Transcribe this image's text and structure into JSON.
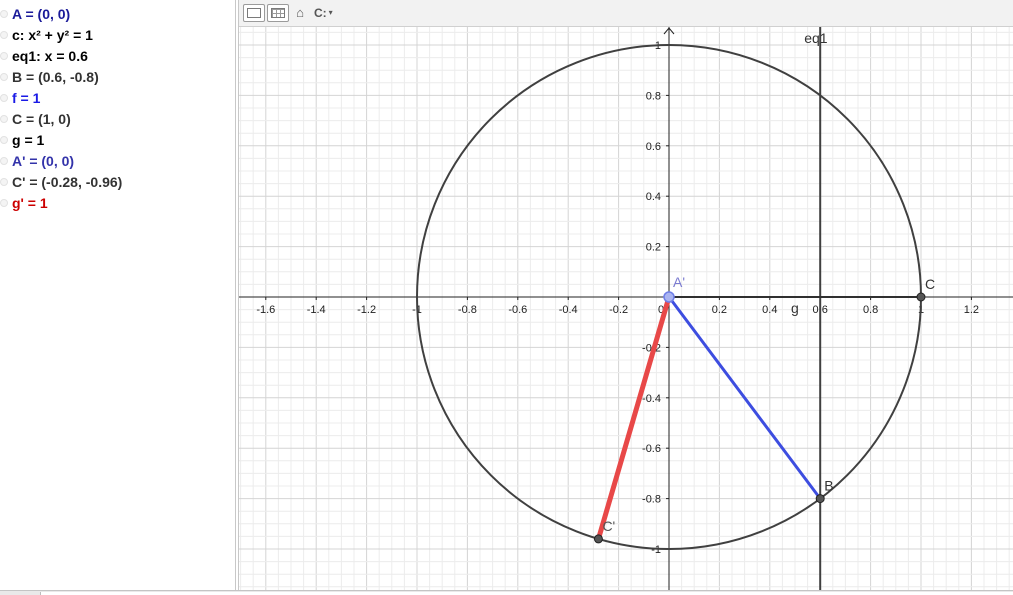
{
  "algebra_view": {
    "items": [
      {
        "text": "A = (0, 0)",
        "color": "#1a1a99"
      },
      {
        "text": "c: x² + y² = 1",
        "color": "#000000"
      },
      {
        "text": "eq1: x = 0.6",
        "color": "#000000"
      },
      {
        "text": "B = (0.6, -0.8)",
        "color": "#333333"
      },
      {
        "text": "f = 1",
        "color": "#1a1ae6"
      },
      {
        "text": "C = (1, 0)",
        "color": "#333333"
      },
      {
        "text": "g = 1",
        "color": "#000000"
      },
      {
        "text": "A' = (0, 0)",
        "color": "#3333aa"
      },
      {
        "text": "C' = (-0.28, -0.96)",
        "color": "#333333"
      },
      {
        "text": "g' = 1",
        "color": "#cc0000"
      }
    ]
  },
  "style_bar": {
    "axes_toggle_icon": "axes-toggle-icon",
    "grid_toggle_icon": "grid-toggle-icon",
    "home_icon": "home-icon",
    "home_glyph": "⌂",
    "caption_style": "C:",
    "caption_caret": "▾"
  },
  "graphics_view": {
    "x_ticks": [
      "-1.6",
      "-1.4",
      "-1.2",
      "-1",
      "-0.8",
      "-0.6",
      "-0.4",
      "-0.2",
      "0",
      "0.2",
      "0.4",
      "0.6",
      "0.8",
      "1",
      "1.2"
    ],
    "y_ticks": [
      "1",
      "0.8",
      "0.6",
      "0.4",
      "0.2",
      "-0.2",
      "-0.4",
      "-0.6",
      "-0.8",
      "-1"
    ],
    "tick_values_x": [
      -1.6,
      -1.4,
      -1.2,
      -1,
      -0.8,
      -0.6,
      -0.4,
      -0.2,
      0,
      0.2,
      0.4,
      0.6,
      0.8,
      1,
      1.2
    ],
    "tick_values_y": [
      1,
      0.8,
      0.6,
      0.4,
      0.2,
      -0.2,
      -0.4,
      -0.6,
      -0.8,
      -1
    ],
    "line_label": "eq1",
    "circle": {
      "name": "c",
      "center": [
        0,
        0
      ],
      "radius": 1,
      "color": "#404040"
    },
    "vertical_line": {
      "name": "eq1",
      "x": 0.6,
      "color": "#404040"
    },
    "points": [
      {
        "name": "A'",
        "x": 0,
        "y": 0,
        "color": "#6f7ee8",
        "label_color": "#7a7ad0"
      },
      {
        "name": "B",
        "x": 0.6,
        "y": -0.8,
        "color": "#404040",
        "label_color": "#333333"
      },
      {
        "name": "C",
        "x": 1,
        "y": 0,
        "color": "#404040",
        "label_color": "#333333"
      },
      {
        "name": "C'",
        "x": -0.28,
        "y": -0.96,
        "color": "#404040",
        "label_color": "#555555"
      }
    ],
    "segments": [
      {
        "name": "f",
        "from": [
          0,
          0
        ],
        "to": [
          0.6,
          -0.8
        ],
        "color": "#3d4de0"
      },
      {
        "name": "g",
        "from": [
          0,
          0
        ],
        "to": [
          1,
          0
        ],
        "color": "#303030",
        "label": "g"
      },
      {
        "name": "g'",
        "from": [
          0,
          0
        ],
        "to": [
          -0.28,
          -0.96
        ],
        "color": "#e84848"
      }
    ]
  }
}
